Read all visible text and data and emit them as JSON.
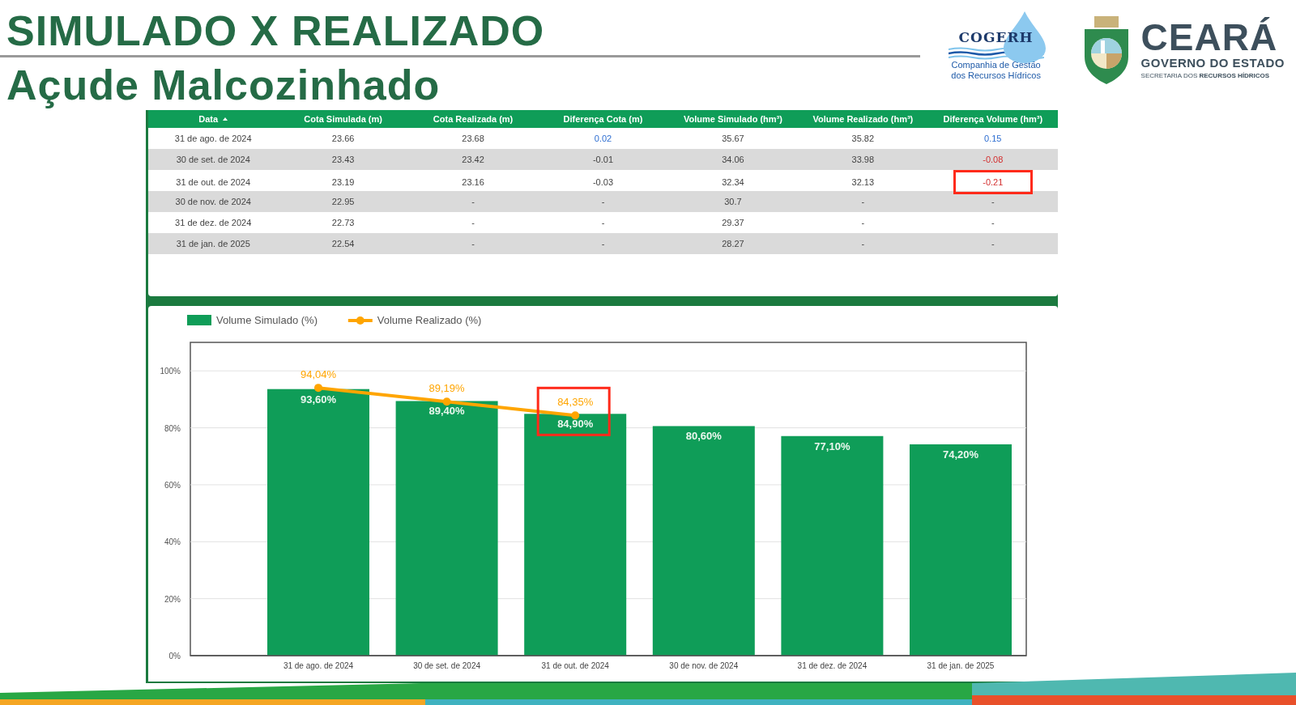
{
  "header": {
    "title": "SIMULADO X REALIZADO",
    "subtitle": "Açude Malcozinhado"
  },
  "logos": {
    "cogerh": {
      "name": "COGERH",
      "line_1": "Companhia de Gestão",
      "line_2": "dos Recursos Hídricos"
    },
    "ceara": {
      "name": "CEARÁ",
      "line_1": "GOVERNO DO ESTADO",
      "line_2": "SECRETARIA DOS **RECURSOS HÍDRICOS**"
    }
  },
  "table": {
    "columns": [
      {
        "label": "Data",
        "sorted": true
      },
      {
        "label": "Cota Simulada (m)",
        "sorted": false
      },
      {
        "label": "Cota Realizada (m)",
        "sorted": false
      },
      {
        "label": "Diferença Cota (m)",
        "sorted": false
      },
      {
        "label": "Volume Simulado (hm³)",
        "sorted": false
      },
      {
        "label": "Volume Realizado (hm³)",
        "sorted": false
      },
      {
        "label": "Diferença Volume (hm³)",
        "sorted": false
      }
    ],
    "rows": [
      {
        "data": "31 de ago. de 2024",
        "cota_simulada": "23.66",
        "cota_realizada": "23.68",
        "diferenca_cota": {
          "text": "0.02",
          "kind": "gain"
        },
        "volume_simulado": "35.67",
        "volume_realizado": "35.82",
        "diferenca_volume": {
          "text": "0.15",
          "kind": "gain"
        },
        "highlighted": false
      },
      {
        "data": "30 de set. de 2024",
        "cota_simulada": "23.43",
        "cota_realizada": "23.42",
        "diferenca_cota": {
          "text": "-0.01",
          "kind": "plain"
        },
        "volume_simulado": "34.06",
        "volume_realizado": "33.98",
        "diferenca_volume": {
          "text": "-0.08",
          "kind": "loss"
        },
        "highlighted": false
      },
      {
        "data": "31 de out. de 2024",
        "cota_simulada": "23.19",
        "cota_realizada": "23.16",
        "diferenca_cota": {
          "text": "-0.03",
          "kind": "plain"
        },
        "volume_simulado": "32.34",
        "volume_realizado": "32.13",
        "diferenca_volume": {
          "text": "-0.21",
          "kind": "loss"
        },
        "highlighted": true
      },
      {
        "data": "30 de nov. de 2024",
        "cota_simulada": "22.95",
        "cota_realizada": "-",
        "diferenca_cota": {
          "text": "-",
          "kind": "plain"
        },
        "volume_simulado": "30.7",
        "volume_realizado": "-",
        "diferenca_volume": {
          "text": "-",
          "kind": "plain"
        },
        "highlighted": false
      },
      {
        "data": "31 de dez. de 2024",
        "cota_simulada": "22.73",
        "cota_realizada": "-",
        "diferenca_cota": {
          "text": "-",
          "kind": "plain"
        },
        "volume_simulado": "29.37",
        "volume_realizado": "-",
        "diferenca_volume": {
          "text": "-",
          "kind": "plain"
        },
        "highlighted": false
      },
      {
        "data": "31 de jan. de 2025",
        "cota_simulada": "22.54",
        "cota_realizada": "-",
        "diferenca_cota": {
          "text": "-",
          "kind": "plain"
        },
        "volume_simulado": "28.27",
        "volume_realizado": "-",
        "diferenca_volume": {
          "text": "-",
          "kind": "plain"
        },
        "highlighted": false
      }
    ]
  },
  "chart": {
    "chart_data": {
      "type": "bar",
      "categories": [
        "31 de ago. de 2024",
        "30 de set. de 2024",
        "31 de out. de 2024",
        "30 de nov. de 2024",
        "31 de dez. de 2024",
        "31 de jan. de 2025"
      ],
      "series": [
        {
          "name": "Volume Simulado (%)",
          "type": "bar",
          "color": "#0f9d58",
          "values": [
            93.6,
            89.4,
            84.9,
            80.6,
            77.1,
            74.2
          ],
          "value_labels": [
            "93,60%",
            "89,40%",
            "84,90%",
            "80,60%",
            "77,10%",
            "74,20%"
          ]
        },
        {
          "name": "Volume Realizado (%)",
          "type": "line",
          "marker": "circle",
          "color": "#ffa500",
          "values": [
            94.04,
            89.19,
            84.35,
            null,
            null,
            null
          ],
          "value_labels": [
            "94,04%",
            "89,19%",
            "84,35%",
            null,
            null,
            null
          ]
        }
      ],
      "ylim": [
        0,
        110
      ],
      "yticks": [
        {
          "value": 0,
          "label": "0%"
        },
        {
          "value": 20,
          "label": "20%"
        },
        {
          "value": 40,
          "label": "40%"
        },
        {
          "value": 60,
          "label": "60%"
        },
        {
          "value": 80,
          "label": "80%"
        },
        {
          "value": 100,
          "label": "100%"
        }
      ],
      "data_labels": true,
      "grid": true,
      "legend": "top"
    },
    "points": [
      {
        "highlighted": false
      },
      {
        "highlighted": false
      },
      {
        "highlighted": true
      },
      {
        "highlighted": false
      },
      {
        "highlighted": false
      },
      {
        "highlighted": false
      }
    ]
  }
}
